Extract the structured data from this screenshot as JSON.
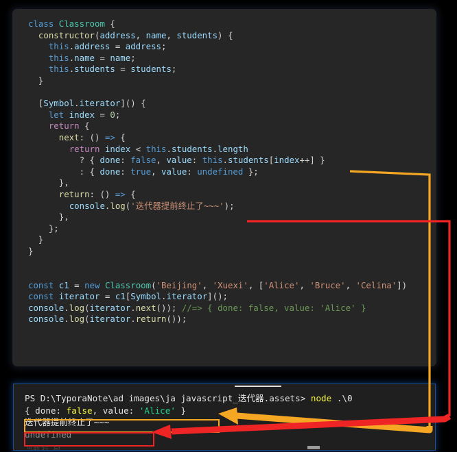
{
  "editor": {
    "language": "javascript",
    "code_lines": [
      {
        "indent": 0,
        "tokens": [
          {
            "t": "class ",
            "c": "kw"
          },
          {
            "t": "Classroom",
            "c": "typ"
          },
          {
            "t": " {",
            "c": "pun"
          }
        ]
      },
      {
        "indent": 1,
        "tokens": [
          {
            "t": "constructor",
            "c": "fn"
          },
          {
            "t": "(",
            "c": "pun"
          },
          {
            "t": "address",
            "c": "var"
          },
          {
            "t": ", ",
            "c": "pun"
          },
          {
            "t": "name",
            "c": "var"
          },
          {
            "t": ", ",
            "c": "pun"
          },
          {
            "t": "students",
            "c": "var"
          },
          {
            "t": ") {",
            "c": "pun"
          }
        ]
      },
      {
        "indent": 2,
        "tokens": [
          {
            "t": "this",
            "c": "kw"
          },
          {
            "t": ".",
            "c": "pun"
          },
          {
            "t": "address",
            "c": "var"
          },
          {
            "t": " = ",
            "c": "op"
          },
          {
            "t": "address",
            "c": "var"
          },
          {
            "t": ";",
            "c": "pun"
          }
        ]
      },
      {
        "indent": 2,
        "tokens": [
          {
            "t": "this",
            "c": "kw"
          },
          {
            "t": ".",
            "c": "pun"
          },
          {
            "t": "name",
            "c": "var"
          },
          {
            "t": " = ",
            "c": "op"
          },
          {
            "t": "name",
            "c": "var"
          },
          {
            "t": ";",
            "c": "pun"
          }
        ]
      },
      {
        "indent": 2,
        "tokens": [
          {
            "t": "this",
            "c": "kw"
          },
          {
            "t": ".",
            "c": "pun"
          },
          {
            "t": "students",
            "c": "var"
          },
          {
            "t": " = ",
            "c": "op"
          },
          {
            "t": "students",
            "c": "var"
          },
          {
            "t": ";",
            "c": "pun"
          }
        ]
      },
      {
        "indent": 1,
        "tokens": [
          {
            "t": "}",
            "c": "pun"
          }
        ]
      },
      {
        "indent": 0,
        "tokens": []
      },
      {
        "indent": 1,
        "tokens": [
          {
            "t": "[",
            "c": "pun"
          },
          {
            "t": "Symbol",
            "c": "var"
          },
          {
            "t": ".",
            "c": "pun"
          },
          {
            "t": "iterator",
            "c": "var"
          },
          {
            "t": "]() {",
            "c": "pun"
          }
        ]
      },
      {
        "indent": 2,
        "tokens": [
          {
            "t": "let",
            "c": "kw"
          },
          {
            "t": " ",
            "c": "pun"
          },
          {
            "t": "index",
            "c": "var"
          },
          {
            "t": " = ",
            "c": "op"
          },
          {
            "t": "0",
            "c": "num"
          },
          {
            "t": ";",
            "c": "pun"
          }
        ]
      },
      {
        "indent": 2,
        "tokens": [
          {
            "t": "return",
            "c": "ctl"
          },
          {
            "t": " {",
            "c": "pun"
          }
        ]
      },
      {
        "indent": 3,
        "tokens": [
          {
            "t": "next",
            "c": "fn"
          },
          {
            "t": ": () ",
            "c": "pun"
          },
          {
            "t": "=>",
            "c": "kw"
          },
          {
            "t": " {",
            "c": "pun"
          }
        ]
      },
      {
        "indent": 4,
        "tokens": [
          {
            "t": "return",
            "c": "ctl"
          },
          {
            "t": " ",
            "c": "pun"
          },
          {
            "t": "index",
            "c": "var"
          },
          {
            "t": " < ",
            "c": "op"
          },
          {
            "t": "this",
            "c": "kw"
          },
          {
            "t": ".",
            "c": "pun"
          },
          {
            "t": "students",
            "c": "var"
          },
          {
            "t": ".",
            "c": "pun"
          },
          {
            "t": "length",
            "c": "var"
          }
        ]
      },
      {
        "indent": 5,
        "tokens": [
          {
            "t": "? { ",
            "c": "pun"
          },
          {
            "t": "done",
            "c": "var"
          },
          {
            "t": ": ",
            "c": "pun"
          },
          {
            "t": "false",
            "c": "kw"
          },
          {
            "t": ", ",
            "c": "pun"
          },
          {
            "t": "value",
            "c": "var"
          },
          {
            "t": ": ",
            "c": "pun"
          },
          {
            "t": "this",
            "c": "kw"
          },
          {
            "t": ".",
            "c": "pun"
          },
          {
            "t": "students",
            "c": "var"
          },
          {
            "t": "[",
            "c": "pun"
          },
          {
            "t": "index",
            "c": "var"
          },
          {
            "t": "++] }",
            "c": "pun"
          }
        ]
      },
      {
        "indent": 5,
        "tokens": [
          {
            "t": ": { ",
            "c": "pun"
          },
          {
            "t": "done",
            "c": "var"
          },
          {
            "t": ": ",
            "c": "pun"
          },
          {
            "t": "true",
            "c": "kw"
          },
          {
            "t": ", ",
            "c": "pun"
          },
          {
            "t": "value",
            "c": "var"
          },
          {
            "t": ": ",
            "c": "pun"
          },
          {
            "t": "undefined",
            "c": "kw"
          },
          {
            "t": " };",
            "c": "pun"
          }
        ]
      },
      {
        "indent": 3,
        "tokens": [
          {
            "t": "},",
            "c": "pun"
          }
        ]
      },
      {
        "indent": 3,
        "tokens": [
          {
            "t": "return",
            "c": "fn"
          },
          {
            "t": ": () ",
            "c": "pun"
          },
          {
            "t": "=>",
            "c": "kw"
          },
          {
            "t": " {",
            "c": "pun"
          }
        ]
      },
      {
        "indent": 4,
        "tokens": [
          {
            "t": "console",
            "c": "var"
          },
          {
            "t": ".",
            "c": "pun"
          },
          {
            "t": "log",
            "c": "fn"
          },
          {
            "t": "(",
            "c": "pun"
          },
          {
            "t": "'迭代器提前终止了~~~'",
            "c": "str"
          },
          {
            "t": ");",
            "c": "pun"
          }
        ]
      },
      {
        "indent": 3,
        "tokens": [
          {
            "t": "},",
            "c": "pun"
          }
        ]
      },
      {
        "indent": 2,
        "tokens": [
          {
            "t": "};",
            "c": "pun"
          }
        ]
      },
      {
        "indent": 1,
        "tokens": [
          {
            "t": "}",
            "c": "pun"
          }
        ]
      },
      {
        "indent": 0,
        "tokens": [
          {
            "t": "}",
            "c": "pun"
          }
        ]
      },
      {
        "indent": 0,
        "tokens": []
      },
      {
        "indent": 0,
        "tokens": []
      },
      {
        "indent": 0,
        "tokens": [
          {
            "t": "const",
            "c": "kw"
          },
          {
            "t": " ",
            "c": "pun"
          },
          {
            "t": "c1",
            "c": "var"
          },
          {
            "t": " = ",
            "c": "op"
          },
          {
            "t": "new",
            "c": "kw"
          },
          {
            "t": " ",
            "c": "pun"
          },
          {
            "t": "Classroom",
            "c": "typ"
          },
          {
            "t": "(",
            "c": "pun"
          },
          {
            "t": "'Beijing'",
            "c": "str"
          },
          {
            "t": ", ",
            "c": "pun"
          },
          {
            "t": "'Xuexi'",
            "c": "str"
          },
          {
            "t": ", [",
            "c": "pun"
          },
          {
            "t": "'Alice'",
            "c": "str"
          },
          {
            "t": ", ",
            "c": "pun"
          },
          {
            "t": "'Bruce'",
            "c": "str"
          },
          {
            "t": ", ",
            "c": "pun"
          },
          {
            "t": "'Celina'",
            "c": "str"
          },
          {
            "t": "])",
            "c": "pun"
          }
        ]
      },
      {
        "indent": 0,
        "tokens": [
          {
            "t": "const",
            "c": "kw"
          },
          {
            "t": " ",
            "c": "pun"
          },
          {
            "t": "iterator",
            "c": "var"
          },
          {
            "t": " = ",
            "c": "op"
          },
          {
            "t": "c1",
            "c": "var"
          },
          {
            "t": "[",
            "c": "pun"
          },
          {
            "t": "Symbol",
            "c": "var"
          },
          {
            "t": ".",
            "c": "pun"
          },
          {
            "t": "iterator",
            "c": "var"
          },
          {
            "t": "]();",
            "c": "pun"
          }
        ]
      },
      {
        "indent": 0,
        "tokens": [
          {
            "t": "console",
            "c": "var"
          },
          {
            "t": ".",
            "c": "pun"
          },
          {
            "t": "log",
            "c": "fn"
          },
          {
            "t": "(",
            "c": "pun"
          },
          {
            "t": "iterator",
            "c": "var"
          },
          {
            "t": ".",
            "c": "pun"
          },
          {
            "t": "next",
            "c": "fn"
          },
          {
            "t": "());",
            "c": "pun"
          },
          {
            "t": " //=> { done: false, value: 'Alice' }",
            "c": "cmt"
          }
        ]
      },
      {
        "indent": 0,
        "tokens": [
          {
            "t": "console",
            "c": "var"
          },
          {
            "t": ".",
            "c": "pun"
          },
          {
            "t": "log",
            "c": "fn"
          },
          {
            "t": "(",
            "c": "pun"
          },
          {
            "t": "iterator",
            "c": "var"
          },
          {
            "t": ".",
            "c": "pun"
          },
          {
            "t": "return",
            "c": "fn"
          },
          {
            "t": "());",
            "c": "pun"
          }
        ]
      }
    ]
  },
  "terminal": {
    "lines": [
      {
        "segments": [
          {
            "t": "PS D:\\TyporaNote\\ad images\\ja javascript_迭代器.assets> ",
            "c": "t-white"
          },
          {
            "t": "node",
            "c": "t-yellow"
          },
          {
            "t": " .\\0",
            "c": "t-white"
          }
        ]
      },
      {
        "segments": [
          {
            "t": "{ done: ",
            "c": "t-white"
          },
          {
            "t": "false",
            "c": "t-yellow"
          },
          {
            "t": ", value: ",
            "c": "t-white"
          },
          {
            "t": "'Alice'",
            "c": "t-green"
          },
          {
            "t": " }",
            "c": "t-white"
          }
        ]
      },
      {
        "segments": [
          {
            "t": "迭代器提前终止了~~~",
            "c": "t-white"
          }
        ]
      },
      {
        "segments": [
          {
            "t": "undefined",
            "c": "t-grey"
          }
        ]
      }
    ],
    "ghost_bottom_text": "当前 行, 列"
  },
  "annotations": {
    "orange_color": "#f5a623",
    "red_color": "#ef2424",
    "orange_highlight_label": "{ done: false, value: 'Alice' }",
    "red_highlight_label": "迭代器提前终止了~~~"
  },
  "colors": {
    "page_background": "#000000",
    "editor_background": "#262626",
    "terminal_background": "#1f1f1f",
    "terminal_border": "#1c4f91",
    "keyword": "#569cd6",
    "type": "#4ec9b0",
    "function": "#dcdcaa",
    "variable": "#9cdcfe",
    "string": "#ce9178",
    "number": "#b5cea8",
    "comment": "#6a9955",
    "control": "#c586c0",
    "default_text": "#d4d4d4"
  }
}
